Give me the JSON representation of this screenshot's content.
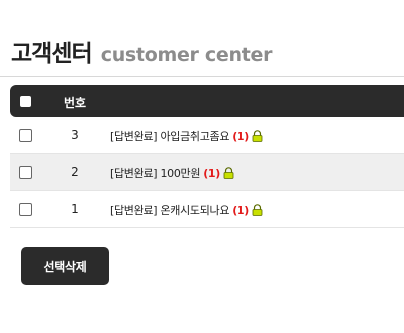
{
  "header": {
    "title": "고객센터",
    "subtitle": "customer center"
  },
  "table": {
    "columns": {
      "number": "번호"
    },
    "rows": [
      {
        "num": "3",
        "subject": "[답변완료] 아입금취고좀요",
        "count": "(1)",
        "locked": true
      },
      {
        "num": "2",
        "subject": "[답변완료] 100만원",
        "count": "(1)",
        "locked": true
      },
      {
        "num": "1",
        "subject": "[답변완료] 온캐시도되나요",
        "count": "(1)",
        "locked": true
      }
    ]
  },
  "actions": {
    "delete_label": "선택삭제"
  },
  "icons": {
    "lock": "lock-icon",
    "lock_color": "#c8e000"
  },
  "colors": {
    "header_bg": "#2b2b2b",
    "count_red": "#e21b1b",
    "alt_row": "#efefef"
  }
}
